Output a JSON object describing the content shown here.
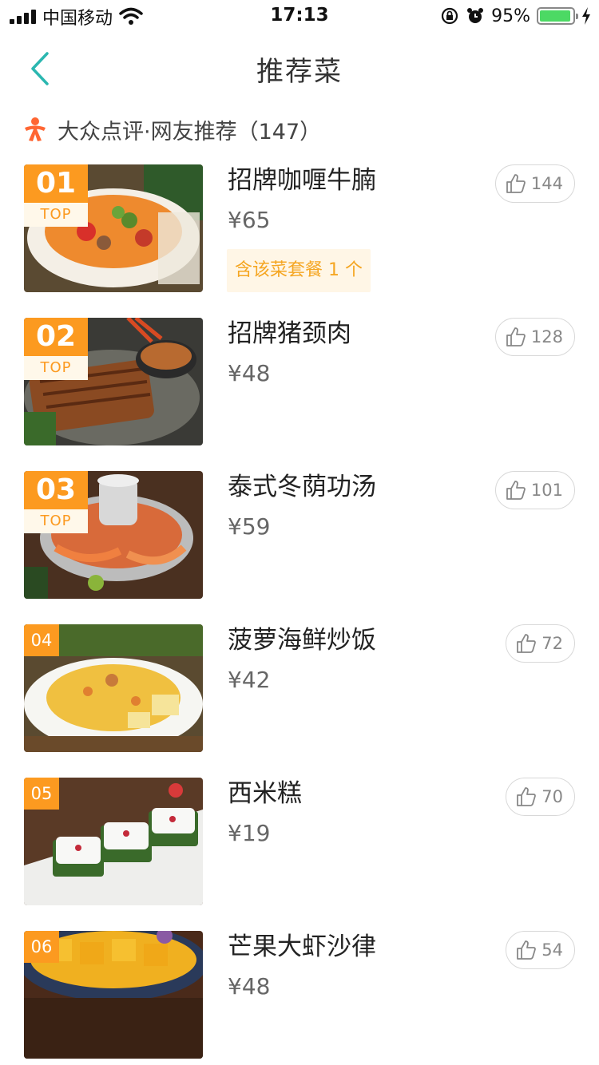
{
  "status_bar": {
    "carrier": "中国移动",
    "time": "17:13",
    "battery": "95%",
    "battery_level": 0.95
  },
  "nav": {
    "title": "推荐菜"
  },
  "source": {
    "label": "大众点评·网友推荐（147）",
    "icon": "dianping-person-icon",
    "accent": "#ff6633"
  },
  "colors": {
    "rank_orange": "#fc9a20",
    "back_teal": "#2bb7b0",
    "combo_text": "#f5a622"
  },
  "dishes": [
    {
      "rank": "01",
      "top_label": "TOP",
      "name": "招牌咖喱牛腩",
      "price": "¥65",
      "likes": "144",
      "combo": "含该菜套餐 1 个"
    },
    {
      "rank": "02",
      "top_label": "TOP",
      "name": "招牌猪颈肉",
      "price": "¥48",
      "likes": "128"
    },
    {
      "rank": "03",
      "top_label": "TOP",
      "name": "泰式冬荫功汤",
      "price": "¥59",
      "likes": "101"
    },
    {
      "rank": "04",
      "name": "菠萝海鲜炒饭",
      "price": "¥42",
      "likes": "72"
    },
    {
      "rank": "05",
      "name": "西米糕",
      "price": "¥19",
      "likes": "70"
    },
    {
      "rank": "06",
      "name": "芒果大虾沙律",
      "price": "¥48",
      "likes": "54"
    }
  ]
}
